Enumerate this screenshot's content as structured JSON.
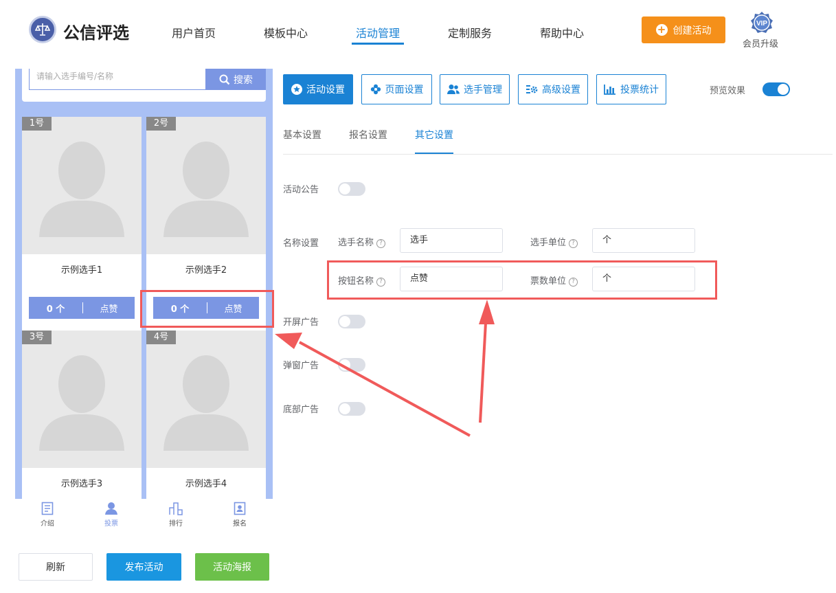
{
  "header": {
    "logo_text": "公信评选",
    "nav": [
      "用户首页",
      "模板中心",
      "活动管理",
      "定制服务",
      "帮助中心"
    ],
    "create_label": "创建活动",
    "vip_badge": "VIP",
    "vip_label": "会员升级"
  },
  "preview": {
    "search_placeholder": "请输入选手编号/名称",
    "search_label": "搜索",
    "contestants": [
      {
        "num": "1号",
        "name": "示例选手1",
        "votes": "0 个",
        "like": "点赞"
      },
      {
        "num": "2号",
        "name": "示例选手2",
        "votes": "0 个",
        "like": "点赞"
      },
      {
        "num": "3号",
        "name": "示例选手3"
      },
      {
        "num": "4号",
        "name": "示例选手4"
      }
    ],
    "bottom_nav": [
      "介绍",
      "投票",
      "排行",
      "报名"
    ]
  },
  "actions": {
    "refresh": "刷新",
    "publish": "发布活动",
    "poster": "活动海报"
  },
  "toolbar": {
    "buttons": [
      "活动设置",
      "页面设置",
      "选手管理",
      "高级设置",
      "投票统计"
    ],
    "preview_label": "预览效果",
    "preview_on": true
  },
  "subtabs": [
    "基本设置",
    "报名设置",
    "其它设置"
  ],
  "settings": {
    "notice_label": "活动公告",
    "name_label": "名称设置",
    "contestant_name_label": "选手名称",
    "contestant_name_value": "选手",
    "contestant_unit_label": "选手单位",
    "contestant_unit_value": "个",
    "button_name_label": "按钮名称",
    "button_name_value": "点赞",
    "vote_unit_label": "票数单位",
    "vote_unit_value": "个",
    "splash_ad_label": "开屏广告",
    "popup_ad_label": "弹窗广告",
    "bottom_ad_label": "底部广告",
    "help_glyph": "?"
  },
  "colors": {
    "primary": "#1a82d4",
    "accent": "#f5901a",
    "preview_blue": "#7b96e3",
    "green": "#6cc04a",
    "highlight_red": "#f05a5a"
  }
}
